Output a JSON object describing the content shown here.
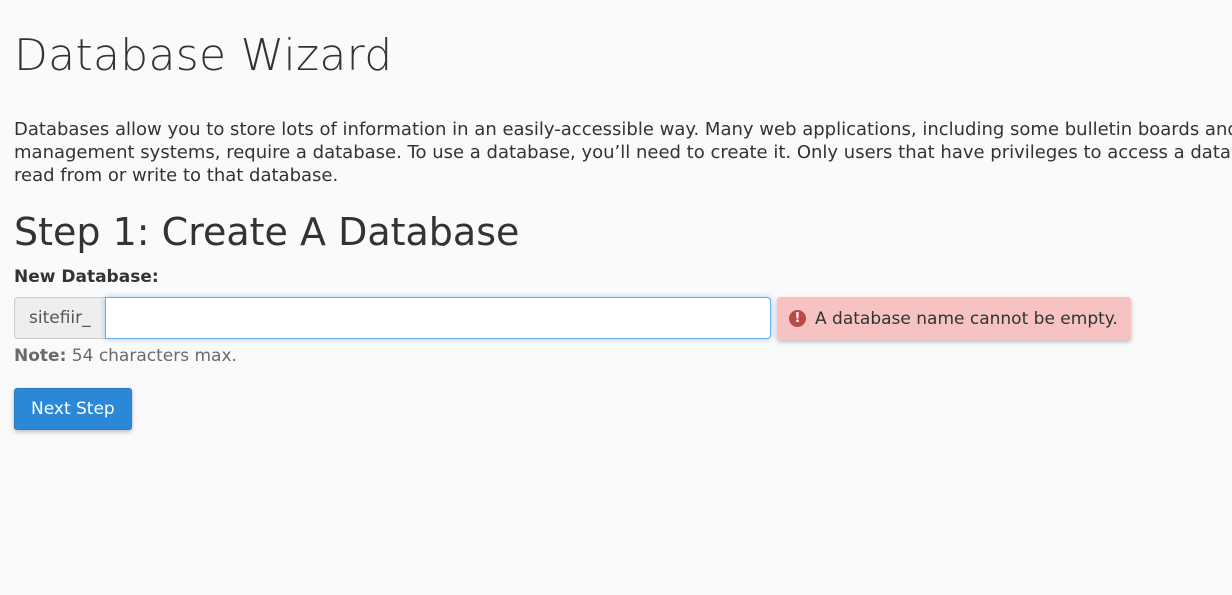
{
  "page": {
    "title": "Database Wizard",
    "description": "Databases allow you to store lots of information in an easily-accessible way. Many web applications, including some bulletin boards and content management systems, require a database. To use a database, you’ll need to create it. Only users that have privileges to access a database can read from or write to that database."
  },
  "step": {
    "title": "Step 1: Create A Database",
    "field_label": "New Database:",
    "prefix": "sitefiir_",
    "input_value": "",
    "error_icon": "!",
    "error_message": "A database name cannot be empty.",
    "note_label": "Note:",
    "note_text": " 54 characters max.",
    "next_label": "Next Step"
  },
  "colors": {
    "primary_button": "#2b88d8",
    "error_background": "#f6c3c2",
    "error_icon": "#b94a48",
    "input_focus_border": "#66afe9"
  }
}
